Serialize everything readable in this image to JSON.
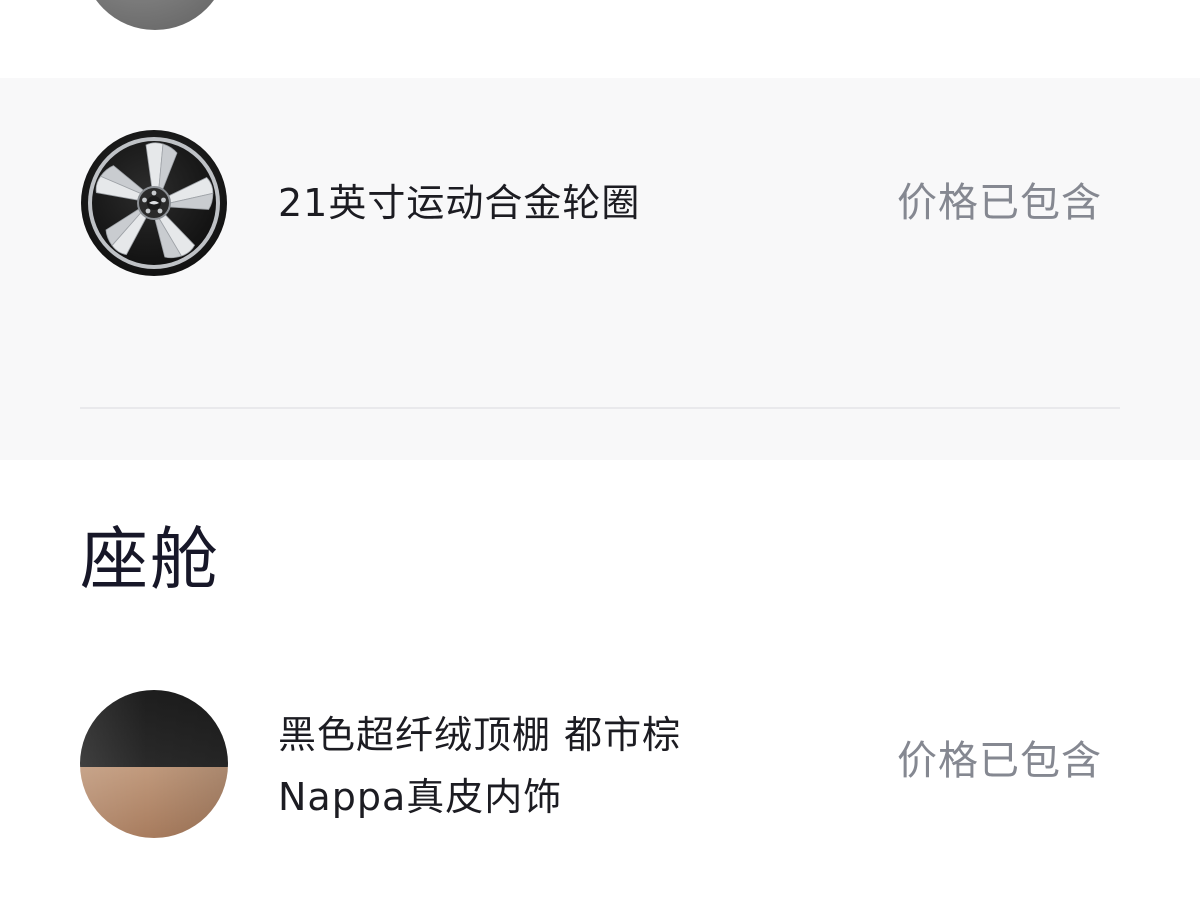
{
  "wheel_option": {
    "name": "21英寸运动合金轮圈",
    "price_label": "价格已包含"
  },
  "cabin": {
    "title": "座舱",
    "interior_option": {
      "name": "黑色超纤绒顶棚 都市棕Nappa真皮内饰",
      "price_label": "价格已包含"
    }
  },
  "colors": {
    "background": "#ffffff",
    "selected_band": "#f8f8f9",
    "text_primary": "#1c1c22",
    "text_secondary": "#858891",
    "title": "#171728",
    "divider": "#e9e9ec"
  },
  "icons": {
    "top_swatch": "grey-paint-swatch",
    "wheel": "alloy-wheel-icon",
    "interior": "black-brown-interior-swatch"
  }
}
